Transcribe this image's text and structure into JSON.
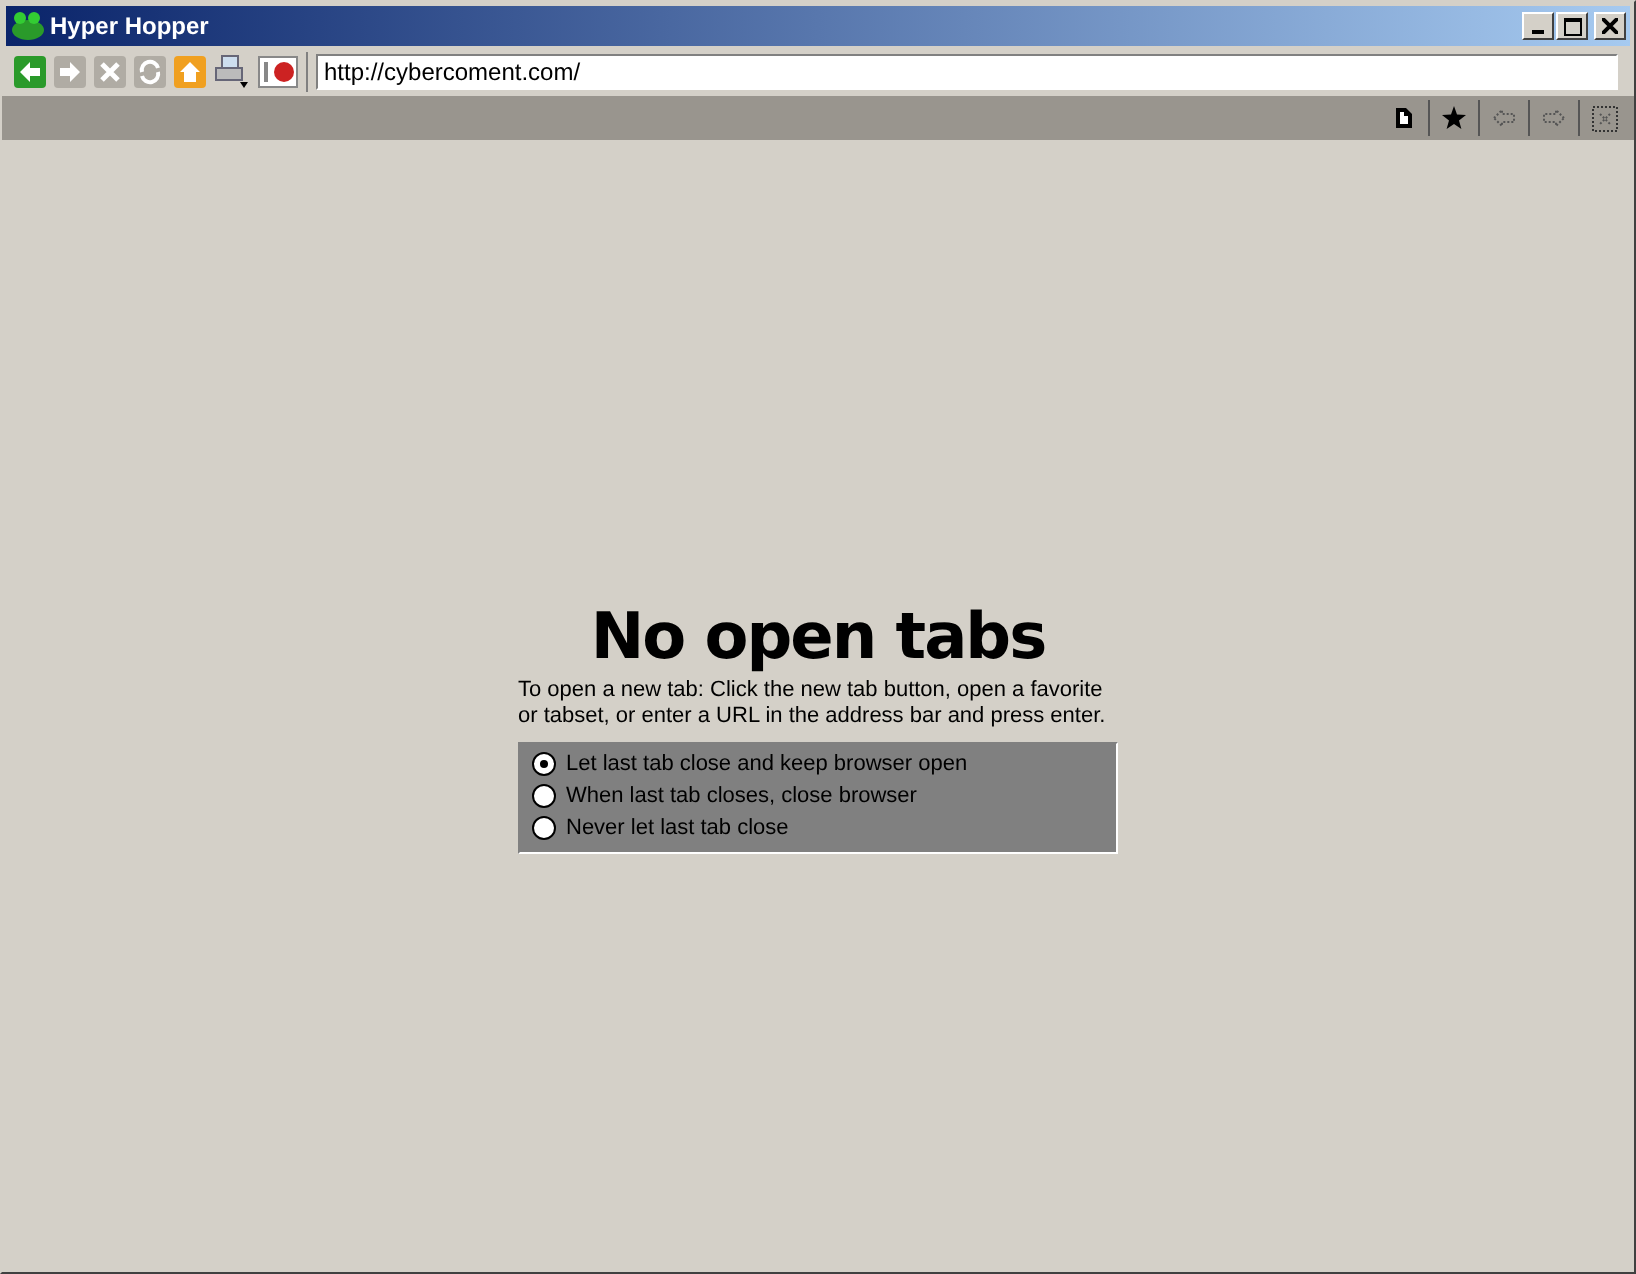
{
  "window": {
    "title": "Hyper Hopper"
  },
  "nav_buttons": [
    {
      "kind": "back",
      "disabled": false
    },
    {
      "kind": "forward",
      "disabled": true
    },
    {
      "kind": "stop",
      "disabled": true
    },
    {
      "kind": "refresh",
      "disabled": true
    },
    {
      "kind": "home",
      "disabled": false
    },
    {
      "kind": "print",
      "disabled": false
    },
    {
      "kind": "plugin",
      "disabled": false
    }
  ],
  "address": {
    "value": "http://cybercoment.com/"
  },
  "tab_buttons": [
    {
      "kind": "new",
      "disabled": false
    },
    {
      "kind": "favorite",
      "disabled": false
    },
    {
      "kind": "prev",
      "disabled": true
    },
    {
      "kind": "next",
      "disabled": true
    },
    {
      "kind": "close",
      "disabled": true
    }
  ],
  "content": {
    "heading": "No open tabs",
    "description": "To open a new tab: Click the new tab button, open a favorite or tabset, or enter a URL in the address bar and press enter.",
    "options": [
      {
        "label": "Let last tab close and keep browser open",
        "selected": true
      },
      {
        "label": "When last tab closes, close browser",
        "selected": false
      },
      {
        "label": "Never let last tab close",
        "selected": false
      }
    ]
  }
}
